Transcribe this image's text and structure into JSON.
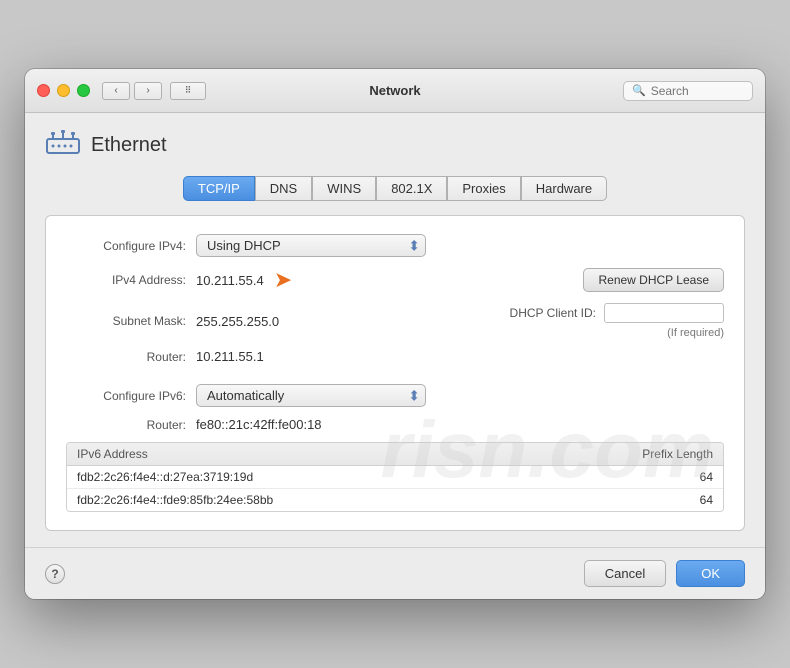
{
  "titlebar": {
    "title": "Network",
    "search_placeholder": "Search"
  },
  "ethernet": {
    "label": "Ethernet"
  },
  "tabs": [
    {
      "label": "TCP/IP",
      "active": true
    },
    {
      "label": "DNS",
      "active": false
    },
    {
      "label": "WINS",
      "active": false
    },
    {
      "label": "802.1X",
      "active": false
    },
    {
      "label": "Proxies",
      "active": false
    },
    {
      "label": "Hardware",
      "active": false
    }
  ],
  "tcpip": {
    "configure_ipv4_label": "Configure IPv4:",
    "configure_ipv4_value": "Using DHCP",
    "ipv4_address_label": "IPv4 Address:",
    "ipv4_address_value": "10.211.55.4",
    "subnet_mask_label": "Subnet Mask:",
    "subnet_mask_value": "255.255.255.0",
    "router_label": "Router:",
    "router_value": "10.211.55.1",
    "renew_btn": "Renew DHCP Lease",
    "dhcp_client_label": "DHCP Client ID:",
    "dhcp_client_placeholder": "",
    "if_required": "(If required)",
    "configure_ipv6_label": "Configure IPv6:",
    "configure_ipv6_value": "Automatically",
    "router_ipv6_label": "Router:",
    "router_ipv6_value": "fe80::21c:42ff:fe00:18",
    "ipv6_table": {
      "col_address": "IPv6 Address",
      "col_prefix": "Prefix Length",
      "rows": [
        {
          "address": "fdb2:2c26:f4e4::d:27ea:3719:19d",
          "prefix": "64"
        },
        {
          "address": "fdb2:2c26:f4e4::fde9:85fb:24ee:58bb",
          "prefix": "64"
        }
      ]
    }
  },
  "bottom": {
    "help_label": "?",
    "cancel_label": "Cancel",
    "ok_label": "OK"
  }
}
